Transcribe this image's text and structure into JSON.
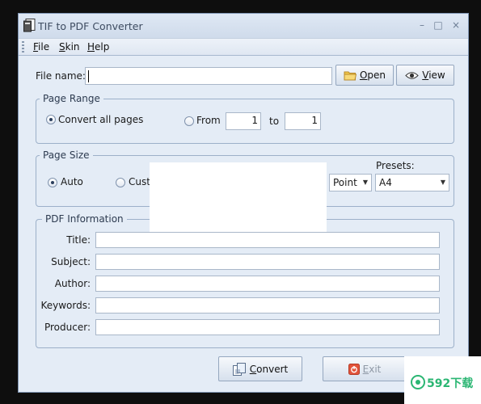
{
  "window": {
    "title": "TIF to PDF Converter",
    "controls": {
      "minimize": "–",
      "maximize": "□",
      "close": "×"
    }
  },
  "menu": {
    "file": {
      "accel": "F",
      "rest": "ile"
    },
    "skin": {
      "accel": "S",
      "rest": "kin"
    },
    "help": {
      "accel": "H",
      "rest": "elp"
    }
  },
  "file": {
    "label": "File name:",
    "value": "",
    "open_button": {
      "accel": "O",
      "rest": "pen",
      "icon": "folder-icon"
    },
    "view_button": {
      "accel": "V",
      "rest": "iew",
      "icon": "eye-icon"
    }
  },
  "page_range": {
    "title": "Page Range",
    "convert_all": "Convert all pages",
    "convert_all_checked": true,
    "from_label": "From",
    "from_value": "1",
    "to_label": "to",
    "to_value": "1"
  },
  "page_size": {
    "title": "Page Size",
    "auto_label": "Auto",
    "auto_checked": true,
    "custom_label": "Custo",
    "unit_value": "Point",
    "presets_label": "Presets:",
    "preset_value": "A4"
  },
  "pdf_info": {
    "title": "PDF Information",
    "fields": [
      {
        "label": "Title:",
        "value": ""
      },
      {
        "label": "Subject:",
        "value": ""
      },
      {
        "label": "Author:",
        "value": ""
      },
      {
        "label": "Keywords:",
        "value": ""
      },
      {
        "label": "Producer:",
        "value": ""
      }
    ]
  },
  "actions": {
    "convert": {
      "accel": "C",
      "rest": "onvert",
      "icon": "convert-icon"
    },
    "exit": {
      "accel": "E",
      "rest": "xit",
      "icon": "power-icon",
      "enabled": false
    }
  },
  "watermark": {
    "text": "592下载"
  },
  "colors": {
    "window_bg": "#e4ecf6",
    "border": "#9cb0c9",
    "watermark_green": "#2bb673"
  }
}
